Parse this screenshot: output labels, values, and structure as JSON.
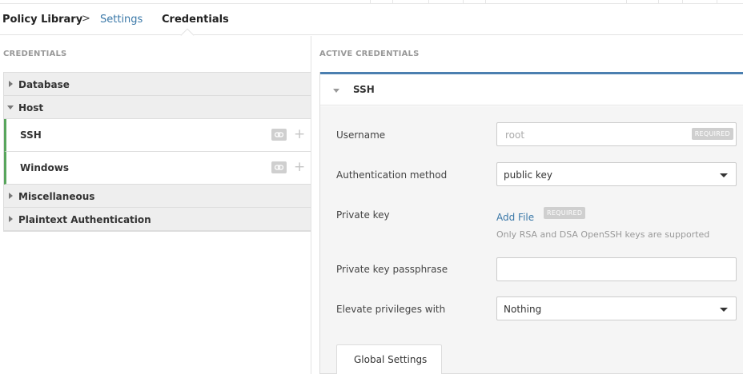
{
  "breadcrumb": {
    "policy_library": "Policy Library",
    "separator": ">",
    "settings": "Settings",
    "credentials": "Credentials"
  },
  "left": {
    "title": "CREDENTIALS",
    "groups": [
      {
        "label": "Database",
        "expanded": false
      },
      {
        "label": "Host",
        "expanded": true,
        "children": [
          {
            "label": "SSH"
          },
          {
            "label": "Windows"
          }
        ]
      },
      {
        "label": "Miscellaneous",
        "expanded": false
      },
      {
        "label": "Plaintext Authentication",
        "expanded": false
      }
    ]
  },
  "right": {
    "title": "ACTIVE CREDENTIALS",
    "card_title": "SSH",
    "username": {
      "label": "Username",
      "placeholder": "root",
      "badge": "REQUIRED"
    },
    "auth_method": {
      "label": "Authentication method",
      "value": "public key"
    },
    "private_key": {
      "label": "Private key",
      "link": "Add File",
      "badge": "REQUIRED",
      "help": "Only RSA and DSA OpenSSH keys are supported"
    },
    "passphrase": {
      "label": "Private key passphrase",
      "value": ""
    },
    "elevate": {
      "label": "Elevate privileges with",
      "value": "Nothing"
    },
    "tab": "Global Settings"
  },
  "colors": {
    "accent": "#4b7fb0",
    "active_border": "#58a55c",
    "link": "#3a78a8"
  }
}
